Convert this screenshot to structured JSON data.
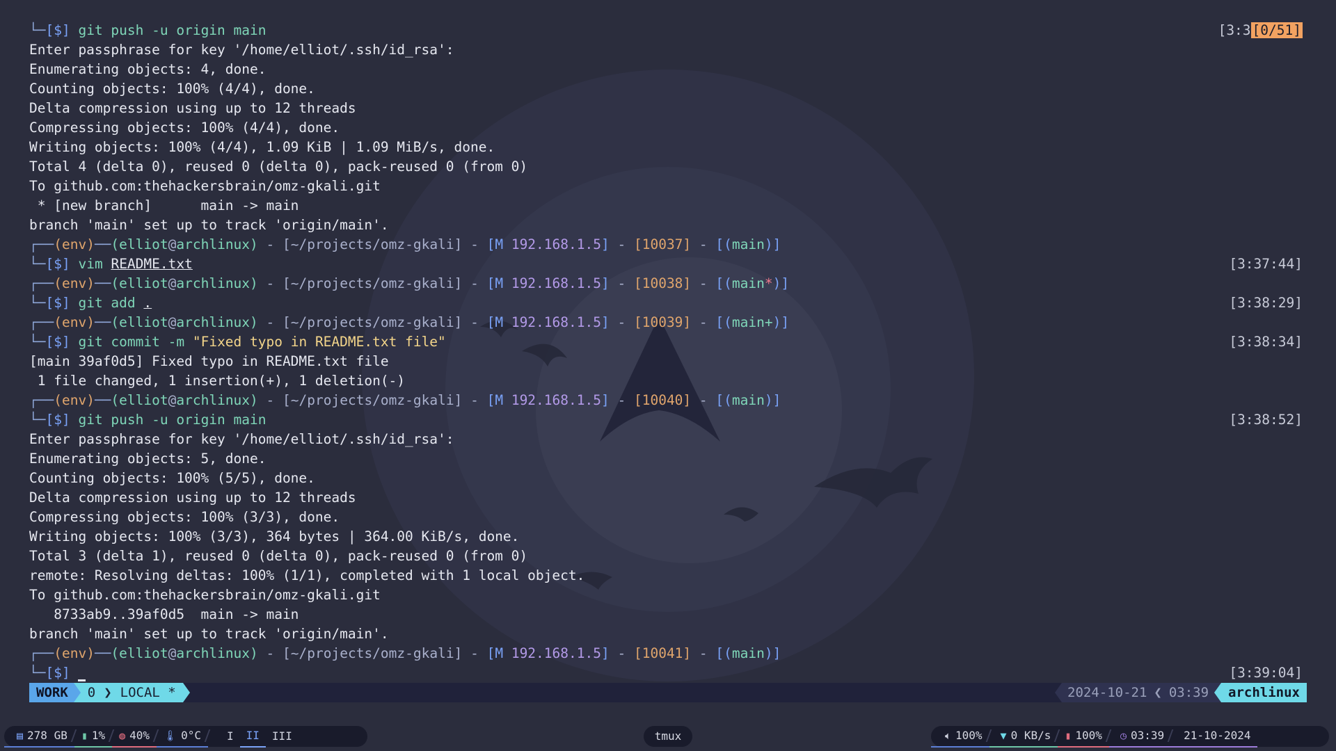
{
  "terminal": {
    "prompt": {
      "env": "(env)",
      "user": "elliot",
      "at": "@",
      "host": "archlinux",
      "path": "[~/projects/omz-gkali]",
      "ip_flag": "M",
      "ip": "192.168.1.5",
      "dash": "-",
      "dollar": "[$]"
    },
    "lines": [
      {
        "type": "cmd",
        "text": "git push -u origin main",
        "ts": "[3:3",
        "ts_highlight": "[0/51]"
      },
      {
        "type": "out",
        "text": "Enter passphrase for key '/home/elliot/.ssh/id_rsa':"
      },
      {
        "type": "out",
        "text": "Enumerating objects: 4, done."
      },
      {
        "type": "out",
        "text": "Counting objects: 100% (4/4), done."
      },
      {
        "type": "out",
        "text": "Delta compression using up to 12 threads"
      },
      {
        "type": "out",
        "text": "Compressing objects: 100% (4/4), done."
      },
      {
        "type": "out",
        "text": "Writing objects: 100% (4/4), 1.09 KiB | 1.09 MiB/s, done."
      },
      {
        "type": "out",
        "text": "Total 4 (delta 0), reused 0 (delta 0), pack-reused 0 (from 0)"
      },
      {
        "type": "out",
        "text": "To github.com:thehackersbrain/omz-gkali.git"
      },
      {
        "type": "out",
        "text": " * [new branch]      main -> main"
      },
      {
        "type": "out",
        "text": "branch 'main' set up to track 'origin/main'."
      },
      {
        "type": "prompt",
        "hist": "10037",
        "branch": "main",
        "mark": ""
      },
      {
        "type": "cmd2",
        "cmd": "vim",
        "arg": "README.txt",
        "ts": "[3:37:44]"
      },
      {
        "type": "prompt",
        "hist": "10038",
        "branch": "main",
        "mark": "*"
      },
      {
        "type": "cmd2",
        "cmd": "git add",
        "arg": ".",
        "ts": "[3:38:29]"
      },
      {
        "type": "prompt",
        "hist": "10039",
        "branch": "main",
        "mark": "+"
      },
      {
        "type": "cmd3",
        "cmd": "git commit -m",
        "str": "\"Fixed typo in README.txt file\"",
        "ts": "[3:38:34]"
      },
      {
        "type": "out",
        "text": "[main 39af0d5] Fixed typo in README.txt file"
      },
      {
        "type": "out",
        "text": " 1 file changed, 1 insertion(+), 1 deletion(-)"
      },
      {
        "type": "prompt",
        "hist": "10040",
        "branch": "main",
        "mark": ""
      },
      {
        "type": "cmd2",
        "cmd": "git push -u origin main",
        "arg": "",
        "ts": "[3:38:52]"
      },
      {
        "type": "out",
        "text": "Enter passphrase for key '/home/elliot/.ssh/id_rsa':"
      },
      {
        "type": "out",
        "text": "Enumerating objects: 5, done."
      },
      {
        "type": "out",
        "text": "Counting objects: 100% (5/5), done."
      },
      {
        "type": "out",
        "text": "Delta compression using up to 12 threads"
      },
      {
        "type": "out",
        "text": "Compressing objects: 100% (3/3), done."
      },
      {
        "type": "out",
        "text": "Writing objects: 100% (3/3), 364 bytes | 364.00 KiB/s, done."
      },
      {
        "type": "out",
        "text": "Total 3 (delta 1), reused 0 (delta 0), pack-reused 0 (from 0)"
      },
      {
        "type": "out",
        "text": "remote: Resolving deltas: 100% (1/1), completed with 1 local object."
      },
      {
        "type": "out",
        "text": "To github.com:thehackersbrain/omz-gkali.git"
      },
      {
        "type": "out",
        "text": "   8733ab9..39af0d5  main -> main"
      },
      {
        "type": "out",
        "text": "branch 'main' set up to track 'origin/main'."
      },
      {
        "type": "prompt",
        "hist": "10041",
        "branch": "main",
        "mark": ""
      },
      {
        "type": "current",
        "ts": "[3:39:04]"
      }
    ]
  },
  "tmux": {
    "session": "WORK",
    "window_index": "0",
    "window_name": "LOCAL *",
    "date": "2024-10-21",
    "time": "03:39",
    "host": "archlinux"
  },
  "sysbar": {
    "disk": "278 GB",
    "cpu": "1%",
    "mem": "40%",
    "temp": "0°C",
    "workspaces": [
      "I",
      "II",
      "III"
    ],
    "active_workspace": "II",
    "center_label": "tmux",
    "volume": "100%",
    "network": "0 KB/s",
    "battery": "100%",
    "clock": "03:39",
    "date": "21-10-2024"
  },
  "colors": {
    "background": "#2b2d3d",
    "accent_blue": "#5aa6ea",
    "accent_cyan": "#6fd9e8",
    "prompt_green": "#7fd6b8",
    "prompt_purple": "#b39ae8",
    "prompt_orange": "#e0a56c",
    "timestamp_highlight": "#f2a261"
  }
}
